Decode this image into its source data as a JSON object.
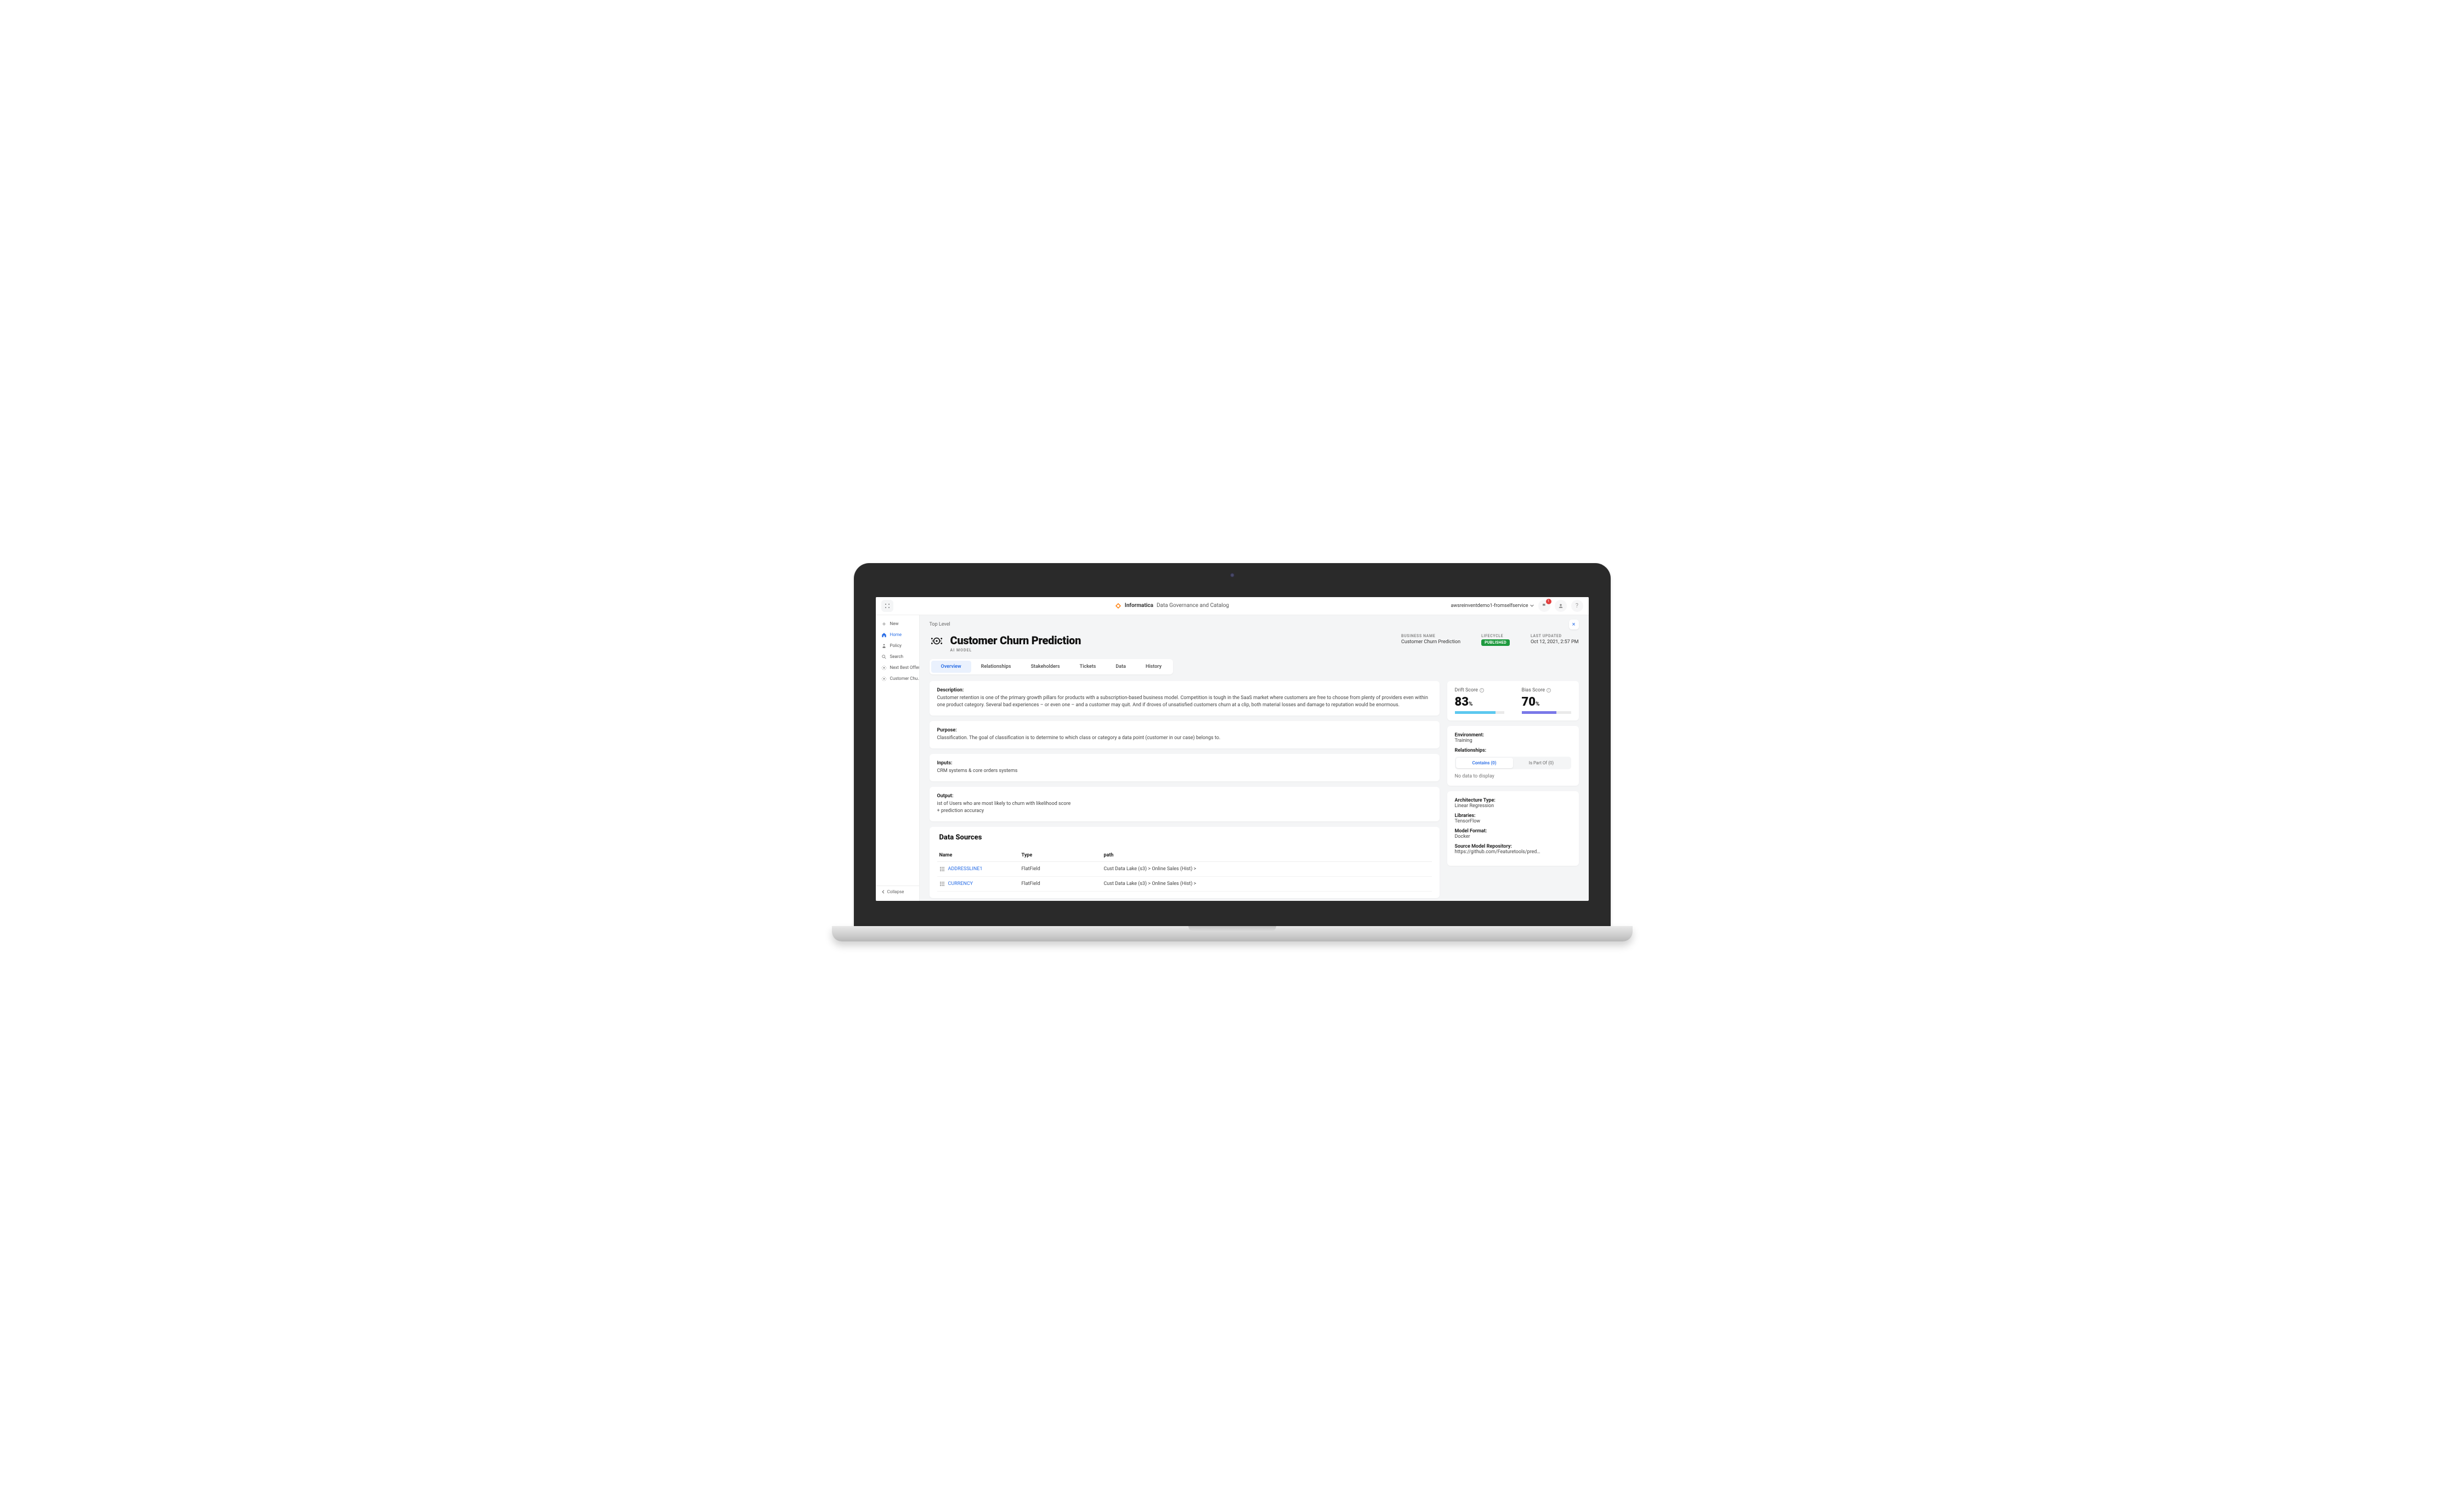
{
  "brand": {
    "name": "Informatica",
    "product": "Data Governance and Catalog"
  },
  "account": {
    "name": "awsreinventdemo1-fromselfservice",
    "notif_count": "1"
  },
  "sidebar": {
    "items": [
      {
        "label": "New"
      },
      {
        "label": "Home"
      },
      {
        "label": "Policy"
      },
      {
        "label": "Search"
      },
      {
        "label": "Next Best Offer"
      },
      {
        "label": "Customer Chu…"
      }
    ],
    "collapse": "Collapse"
  },
  "breadcrumb": "Top Level",
  "page": {
    "title": "Customer Churn Prediction",
    "subtitle": "AI MODEL",
    "meta": {
      "business_name_label": "BUSINESS NAME",
      "business_name": "Customer Churn Prediction",
      "lifecycle_label": "LIFECYCLE",
      "lifecycle": "PUBLISHED",
      "last_updated_label": "LAST UPDATED",
      "last_updated": "Oct 12, 2021, 2:57 PM"
    }
  },
  "tabs": [
    "Overview",
    "Relationships",
    "Stakeholders",
    "Tickets",
    "Data",
    "History"
  ],
  "sections": {
    "description": {
      "label": "Description:",
      "text": "Customer retention is one of the primary growth pillars for products with a subscription-based business model. Competition is tough in the SaaS market where customers are free to choose from plenty of providers even within one product category. Several bad experiences – or even one – and a customer may quit. And if droves of unsatisfied customers churn at a clip, both material losses and damage to reputation would be enormous."
    },
    "purpose": {
      "label": "Purpose:",
      "text": "Classification. The goal of classification is to determine to which class or category a data point (customer in our case) belongs to."
    },
    "inputs": {
      "label": "Inputs:",
      "text": "CRM systems & core orders systems"
    },
    "output": {
      "label": "Output:",
      "text": "ist of Users who are most likely to churn with likelihood score\n+ prediction accuracy"
    }
  },
  "data_sources": {
    "title": "Data Sources",
    "columns": {
      "name": "Name",
      "type": "Type",
      "path": "path"
    },
    "rows": [
      {
        "name": "ADDRESSLINE1",
        "type": "FlatField",
        "path": "Cust Data Lake (s3) > Online Sales (Hist) >"
      },
      {
        "name": "CURRENCY",
        "type": "FlatField",
        "path": "Cust Data Lake (s3) > Online Sales (Hist) >"
      }
    ]
  },
  "scores": {
    "drift": {
      "label": "Drift Score",
      "value": "83",
      "pct": 83,
      "color": "#5cc8ef"
    },
    "bias": {
      "label": "Bias Score",
      "value": "70",
      "pct": 70,
      "color": "#7a78e8"
    }
  },
  "right": {
    "environment": {
      "label": "Environment:",
      "value": "Training"
    },
    "relationships": {
      "label": "Relationships:",
      "tabs": [
        "Contains (0)",
        "Is Part Of (0)"
      ],
      "empty": "No data to display"
    },
    "architecture": {
      "label": "Architecture Type:",
      "value": "Linear Regression"
    },
    "libraries": {
      "label": "Libraries:",
      "value": "TensorFlow"
    },
    "model_format": {
      "label": "Model Format:",
      "value": "Docker"
    },
    "source_repo": {
      "label": "Source Model Repository:",
      "value": "https://github.com/Featuretools/pred…"
    }
  }
}
